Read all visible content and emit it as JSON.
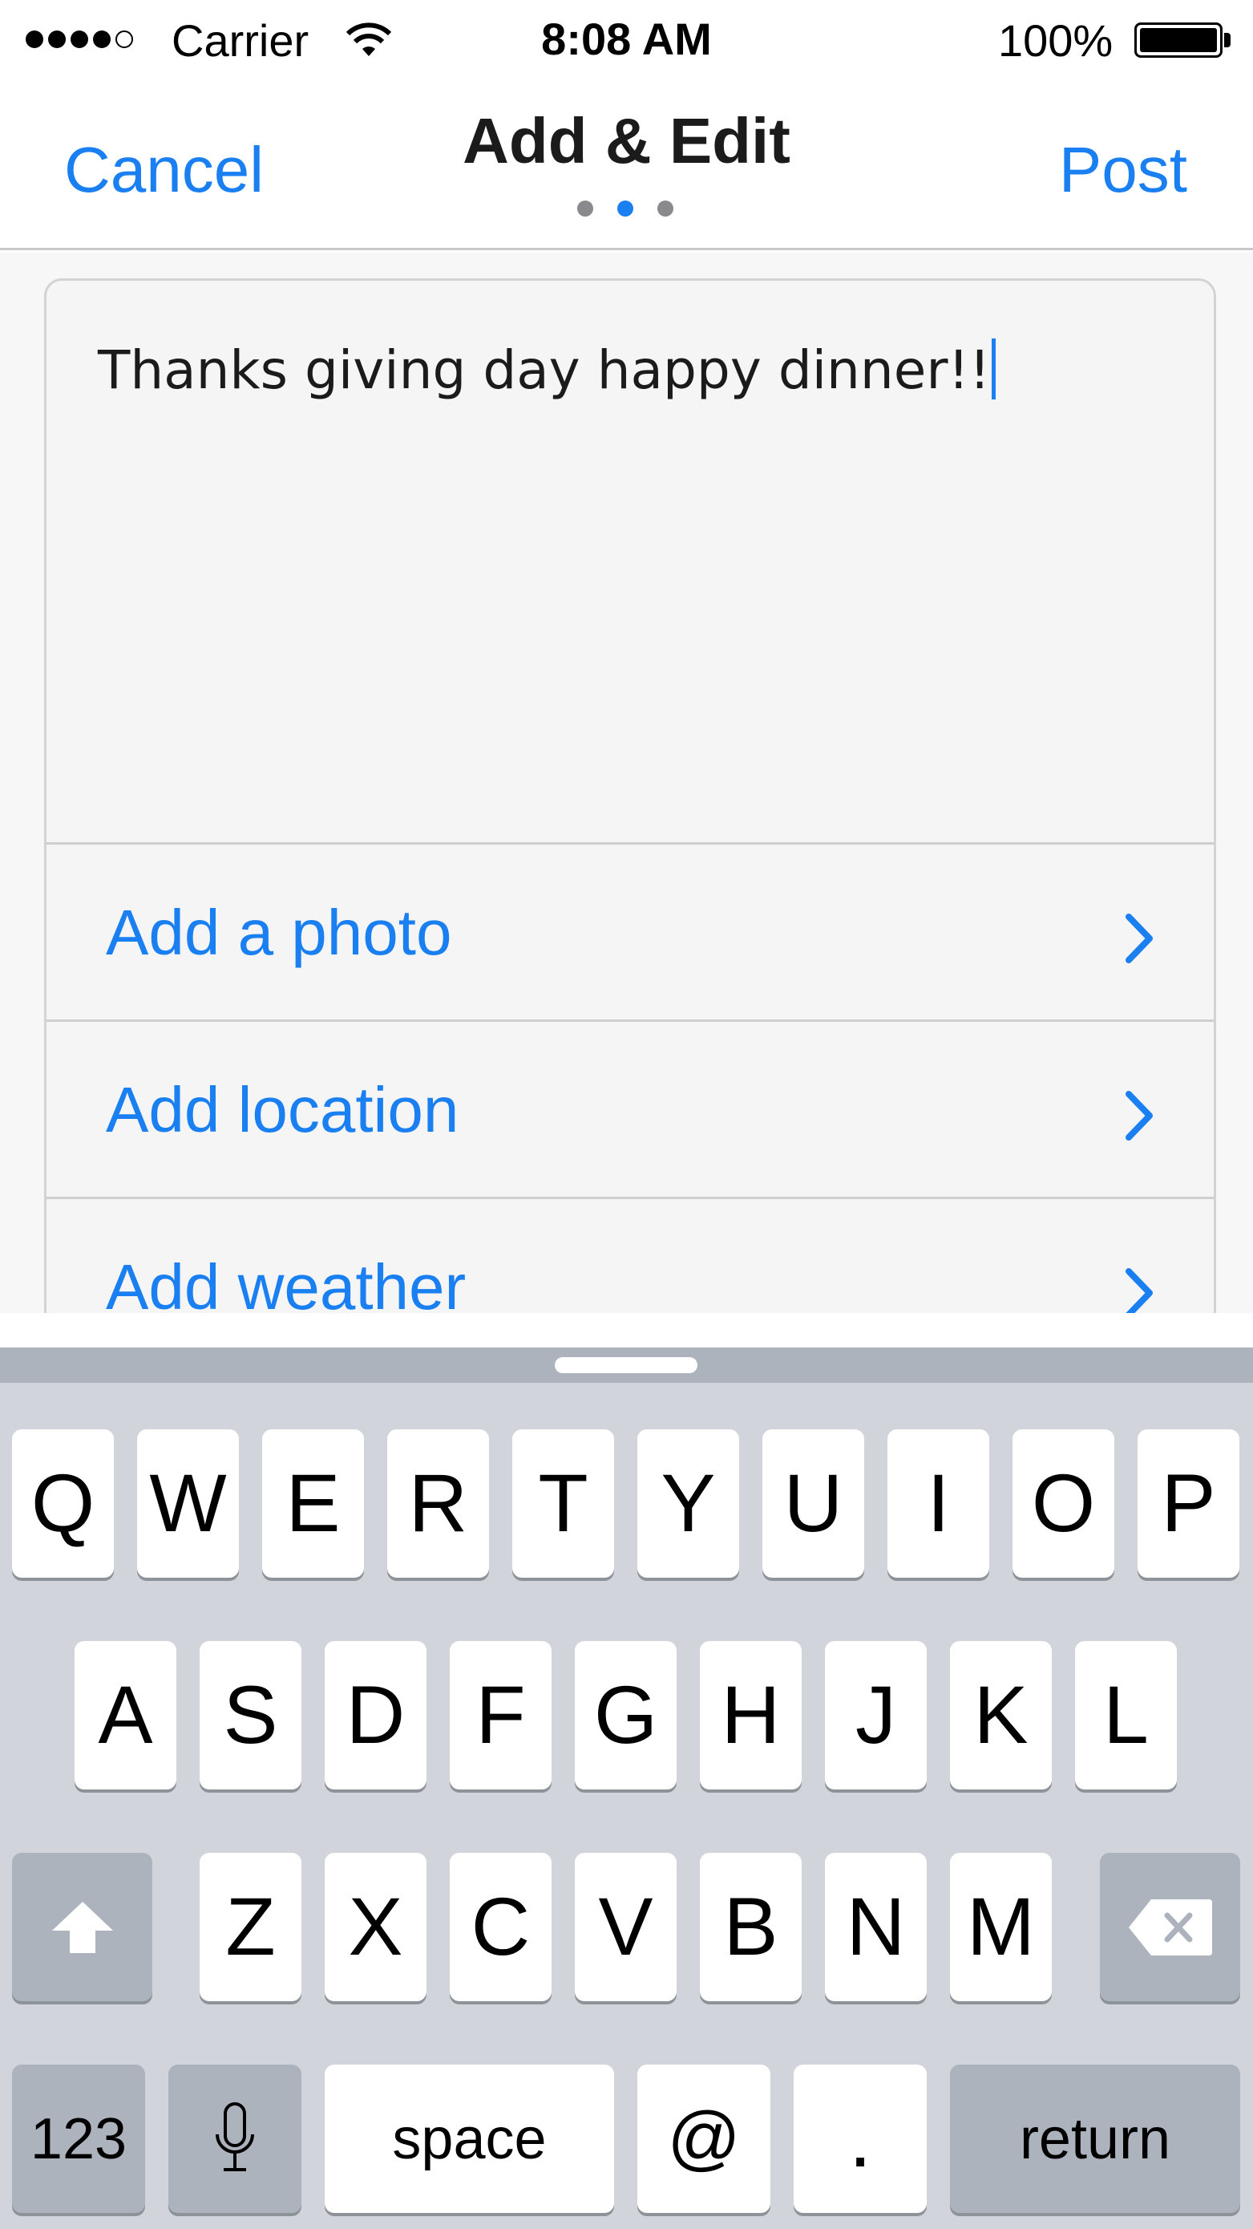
{
  "status_bar": {
    "carrier": "Carrier",
    "time": "8:08 AM",
    "battery_percent": "100%",
    "signal_bars_filled": 4,
    "signal_bars_total": 5
  },
  "nav": {
    "cancel_label": "Cancel",
    "title": "Add & Edit",
    "post_label": "Post",
    "page_count": 3,
    "active_page": 2
  },
  "compose": {
    "text": "Thanks giving day happy dinner!!"
  },
  "options": [
    {
      "label": "Add a photo"
    },
    {
      "label": "Add location"
    },
    {
      "label": "Add weather"
    }
  ],
  "keyboard": {
    "row1": [
      "Q",
      "W",
      "E",
      "R",
      "T",
      "Y",
      "U",
      "I",
      "O",
      "P"
    ],
    "row2": [
      "A",
      "S",
      "D",
      "F",
      "G",
      "H",
      "J",
      "K",
      "L"
    ],
    "row3": [
      "Z",
      "X",
      "C",
      "V",
      "B",
      "N",
      "M"
    ],
    "numbers_label": "123",
    "space_label": "space",
    "at_label": "@",
    "period_label": ".",
    "return_label": "return"
  },
  "colors": {
    "accent": "#1a7ff0",
    "keyboard_bg": "#d1d5db",
    "key_dark": "#adb3bc",
    "content_bg": "#f7f7f7"
  },
  "icons": {
    "wifi": "wifi-icon",
    "battery": "battery-icon",
    "chevron": "chevron-right-icon",
    "shift": "shift-icon",
    "delete": "delete-icon",
    "mic": "microphone-icon"
  }
}
